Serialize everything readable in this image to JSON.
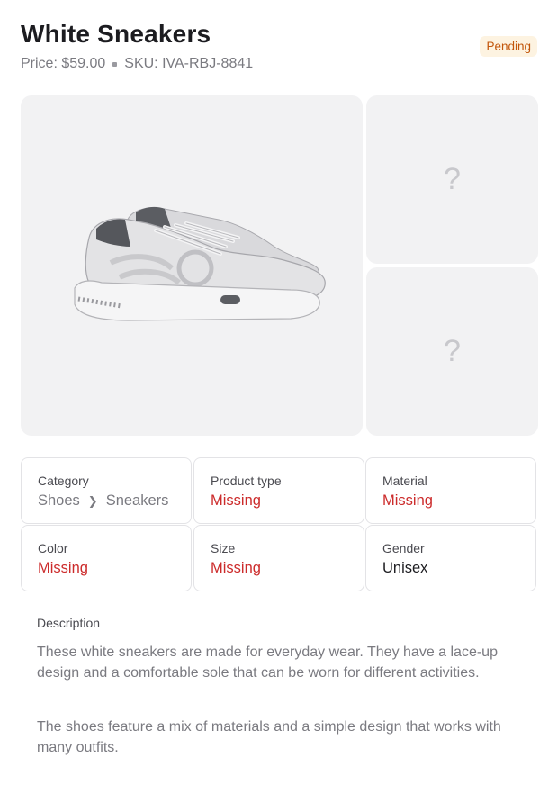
{
  "product": {
    "title": "White Sneakers",
    "price": "Price: $59.00",
    "sku": "SKU: IVA-RBJ-8841",
    "status": "Pending"
  },
  "gallery": {
    "main_image": "white-sneaker-photo",
    "placeholder_glyph": "?"
  },
  "attributes": {
    "category": {
      "label": "Category",
      "path": [
        "Shoes",
        "Sneakers"
      ]
    },
    "product_type": {
      "label": "Product type",
      "value": "Missing"
    },
    "material": {
      "label": "Material",
      "value": "Missing"
    },
    "color": {
      "label": "Color",
      "value": "Missing"
    },
    "size": {
      "label": "Size",
      "value": "Missing"
    },
    "gender": {
      "label": "Gender",
      "value": "Unisex"
    }
  },
  "description": {
    "label": "Description",
    "paragraphs": [
      "These white sneakers are made for everyday wear. They have a lace-up design and a comfortable sole that can be worn for different activities.",
      "The shoes feature a mix of materials and a simple design that works with many outfits."
    ]
  },
  "colors": {
    "missing": "#cc2b2b",
    "badge_bg": "#fdf3e1",
    "badge_text": "#c2560b",
    "tile_bg": "#f2f2f3"
  }
}
